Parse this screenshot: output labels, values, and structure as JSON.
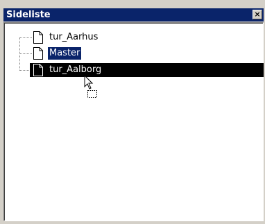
{
  "window": {
    "title": "Sideliste",
    "close_label": "×"
  },
  "tree": {
    "items": [
      {
        "label": "tur_Aarhus",
        "icon": "document-icon",
        "state": "normal"
      },
      {
        "label": "Master",
        "icon": "document-icon",
        "state": "focused-selected"
      },
      {
        "label": "tur_Aalborg",
        "icon": "document-icon",
        "state": "drop-target-highlight"
      }
    ]
  },
  "cursor": {
    "icon": "drag-copy-cursor-icon"
  },
  "colors": {
    "titlebar": "#0a246a",
    "window_bg": "#d4d0c8",
    "selection": "#0a246a",
    "drop_highlight": "#000000",
    "panel_bg": "#ffffff"
  }
}
